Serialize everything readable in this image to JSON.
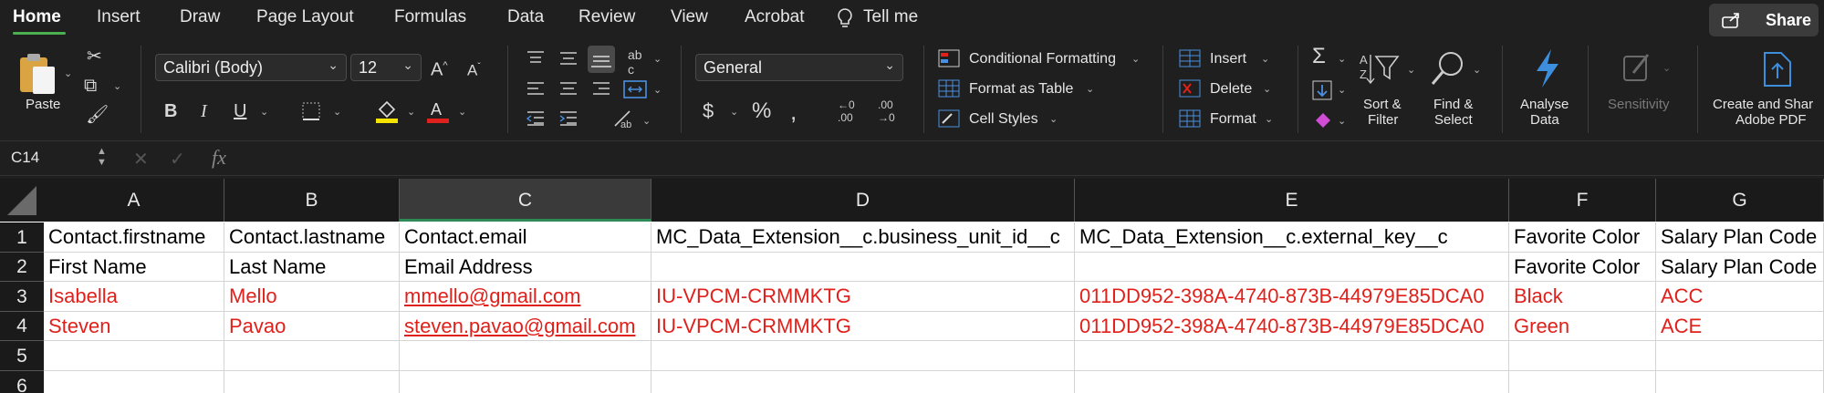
{
  "tabs": [
    "Home",
    "Insert",
    "Draw",
    "Page Layout",
    "Formulas",
    "Data",
    "Review",
    "View",
    "Acrobat",
    "Tell me"
  ],
  "share_label": "Share",
  "ribbon": {
    "paste_label": "Paste",
    "font_name": "Calibri (Body)",
    "font_size": "12",
    "number_format": "General",
    "conditional_formatting": "Conditional Formatting",
    "format_as_table": "Format as Table",
    "cell_styles": "Cell Styles",
    "insert": "Insert",
    "delete": "Delete",
    "format": "Format",
    "sort_filter": [
      "Sort &",
      "Filter"
    ],
    "find_select": [
      "Find &",
      "Select"
    ],
    "analyse_data": [
      "Analyse",
      "Data"
    ],
    "sensitivity": "Sensitivity",
    "create_share": [
      "Create and Shar",
      "Adobe PDF"
    ]
  },
  "formula_bar": {
    "name_box": "C14",
    "fx": "fx"
  },
  "grid": {
    "columns": [
      "A",
      "B",
      "C",
      "D",
      "E",
      "F",
      "G"
    ],
    "selected_column": "C",
    "rows": [
      {
        "num": "1",
        "cells": [
          "Contact.firstname",
          "Contact.lastname",
          "Contact.email",
          "MC_Data_Extension__c.business_unit_id__c",
          "MC_Data_Extension__c.external_key__c",
          "Favorite Color",
          "Salary Plan Code"
        ]
      },
      {
        "num": "2",
        "cells": [
          "First Name",
          "Last Name",
          "Email Address",
          "",
          "",
          "Favorite Color",
          "Salary Plan Code"
        ]
      },
      {
        "num": "3",
        "cells": [
          "Isabella",
          "Mello",
          "mmello@gmail.com",
          "IU-VPCM-CRMMKTG",
          "011DD952-398A-4740-873B-44979E85DCA0",
          "Black",
          "ACC"
        ]
      },
      {
        "num": "4",
        "cells": [
          "Steven",
          "Pavao",
          "steven.pavao@gmail.com",
          "IU-VPCM-CRMMKTG",
          "011DD952-398A-4740-873B-44979E85DCA0",
          "Green",
          "ACE"
        ]
      },
      {
        "num": "5",
        "cells": [
          "",
          "",
          "",
          "",
          "",
          "",
          ""
        ]
      },
      {
        "num": "6",
        "cells": [
          "",
          "",
          "",
          "",
          "",
          "",
          ""
        ]
      }
    ]
  },
  "colors": {
    "accent": "#4caf50",
    "data_red": "#e0201b",
    "analyse_blue": "#3e8ede"
  }
}
